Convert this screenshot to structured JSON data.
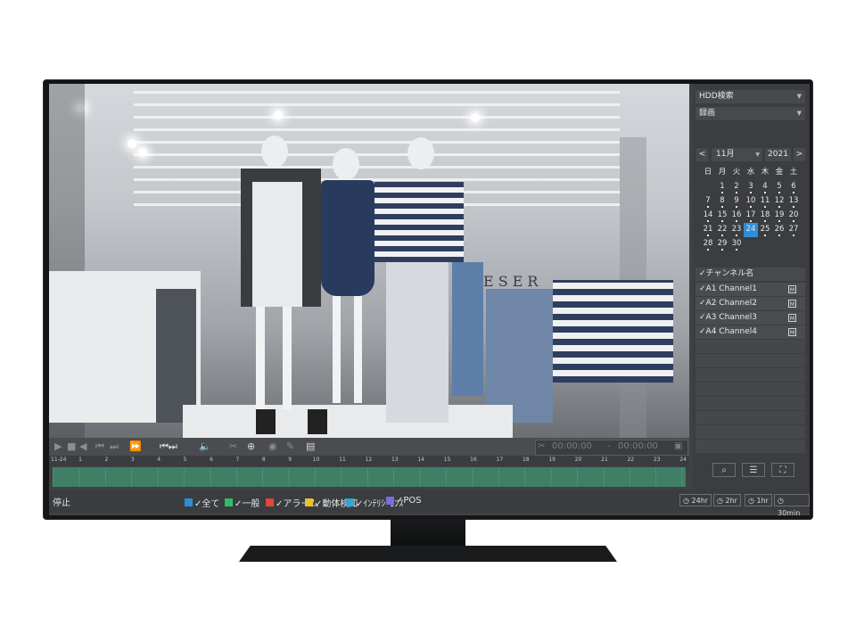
{
  "panel": {
    "search_type": "HDD検索",
    "record_type": "録画",
    "prev": "<",
    "next": ">",
    "month": "11月",
    "year": "2021",
    "weekdays": [
      "日",
      "月",
      "火",
      "水",
      "木",
      "金",
      "土"
    ],
    "calendar_rows": [
      [
        "",
        "1",
        "2",
        "3",
        "4",
        "5",
        "6"
      ],
      [
        "7",
        "8",
        "9",
        "10",
        "11",
        "12",
        "13"
      ],
      [
        "14",
        "15",
        "16",
        "17",
        "18",
        "19",
        "20"
      ],
      [
        "21",
        "22",
        "23",
        "24",
        "25",
        "26",
        "27"
      ],
      [
        "28",
        "29",
        "30",
        "",
        "",
        "",
        ""
      ]
    ],
    "selected_day": "24",
    "channel_header": "✓チャンネル名",
    "channels": [
      "✓A1 Channel1",
      "✓A2 Channel2",
      "✓A3 Channel3",
      "✓A4 Channel4"
    ],
    "channel_badge": "M"
  },
  "video": {
    "sign": "RESER"
  },
  "controls": {
    "time_start": "00:00:00",
    "time_sep": "-",
    "time_end": "00:00:00"
  },
  "timeline": {
    "start_label": "11-24",
    "hours": [
      "1",
      "2",
      "3",
      "4",
      "5",
      "6",
      "7",
      "8",
      "9",
      "10",
      "11",
      "12",
      "13",
      "14",
      "15",
      "16",
      "17",
      "18",
      "19",
      "20",
      "21",
      "22",
      "23",
      "24"
    ]
  },
  "bottom": {
    "status": "停止",
    "legend": [
      {
        "label": "✓全て",
        "color": "#2f8fd6"
      },
      {
        "label": "✓一般",
        "color": "#2bbf6a"
      },
      {
        "label": "✓アラーム",
        "color": "#e0473b"
      },
      {
        "label": "✓動体検知",
        "color": "#e8c034"
      },
      {
        "label": "✓ｲﾝﾃﾘｼﾞｪﾝｽ",
        "color": "#33a3d8"
      },
      {
        "label": "✓POS",
        "color": "#7a6be0"
      }
    ],
    "zoom": [
      "◷ 24hr",
      "◷ 2hr",
      "◷ 1hr",
      "◷ 30min"
    ]
  }
}
